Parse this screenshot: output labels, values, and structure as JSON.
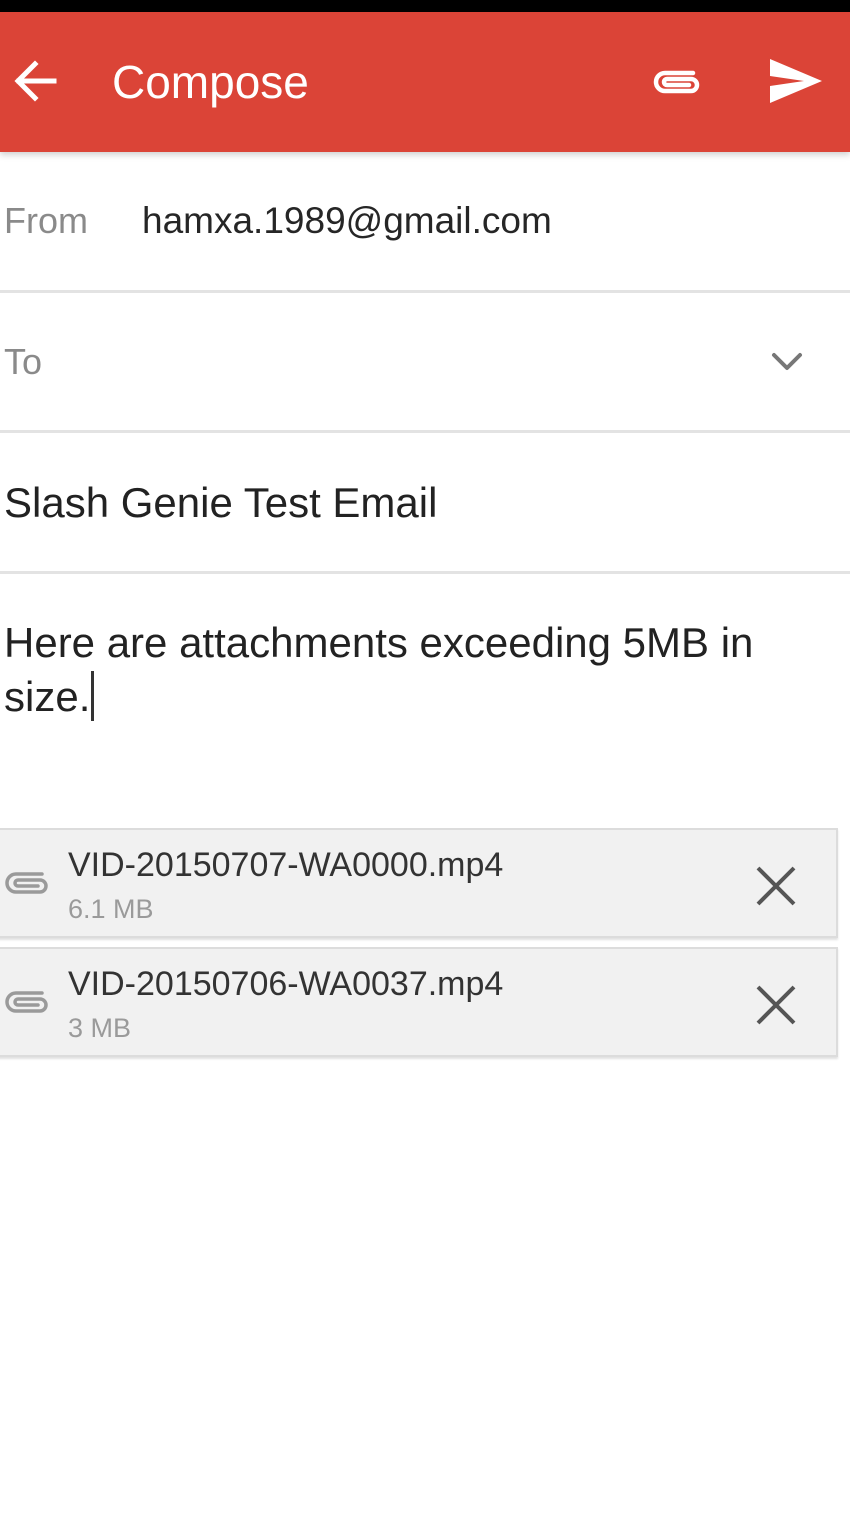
{
  "app_bar": {
    "title": "Compose",
    "color": "#db4437",
    "icons": {
      "back": "arrow-back-icon",
      "attach": "paperclip-icon",
      "send": "send-icon"
    }
  },
  "from": {
    "label": "From",
    "value": "hamxa.1989@gmail.com"
  },
  "to": {
    "label": "To",
    "value": "",
    "icon": "chevron-down-icon"
  },
  "subject": {
    "value": "Slash Genie Test Email"
  },
  "body": {
    "text": "Here are attachments exceeding 5MB in size."
  },
  "attachments": [
    {
      "name": "VID-20150707-WA0000.mp4",
      "size": "6.1 MB",
      "icon": "paperclip-icon",
      "remove_icon": "close-icon"
    },
    {
      "name": "VID-20150706-WA0037.mp4",
      "size": "3 MB",
      "icon": "paperclip-icon",
      "remove_icon": "close-icon"
    }
  ]
}
